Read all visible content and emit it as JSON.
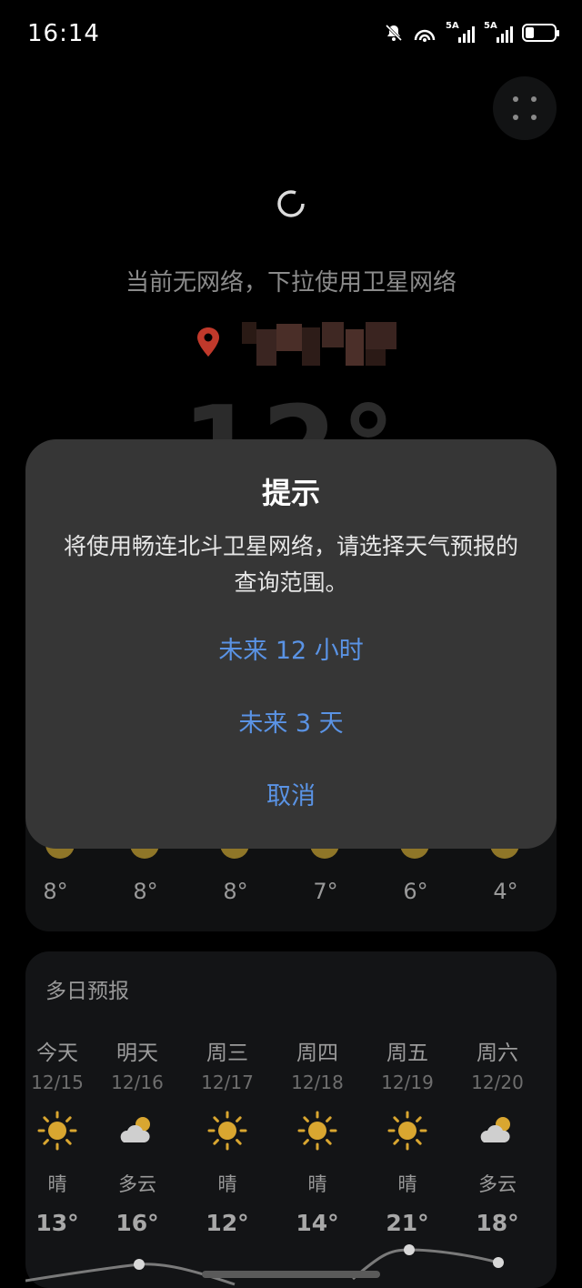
{
  "status_bar": {
    "time": "16:14",
    "signal1_label": "5A",
    "signal2_label": "5A"
  },
  "main": {
    "no_network_text": "当前无网络，下拉使用卫星网络",
    "current_temp": "12°"
  },
  "hourly": {
    "temps": [
      "8°",
      "8°",
      "8°",
      "7°",
      "6°",
      "4°"
    ]
  },
  "dialog": {
    "title": "提示",
    "message": "将使用畅连北斗卫星网络，请选择天气预报的查询范围。",
    "option_12h": "未来 12 小时",
    "option_3d": "未来 3 天",
    "cancel": "取消"
  },
  "forecast": {
    "title": "多日预报",
    "days": [
      {
        "name": "今天",
        "date": "12/15",
        "icon": "sun-icon",
        "cond": "晴",
        "temp": "13°"
      },
      {
        "name": "明天",
        "date": "12/16",
        "icon": "partly-cloudy-icon",
        "cond": "多云",
        "temp": "16°"
      },
      {
        "name": "周三",
        "date": "12/17",
        "icon": "sun-icon",
        "cond": "晴",
        "temp": "12°"
      },
      {
        "name": "周四",
        "date": "12/18",
        "icon": "sun-icon",
        "cond": "晴",
        "temp": "14°"
      },
      {
        "name": "周五",
        "date": "12/19",
        "icon": "sun-icon",
        "cond": "晴",
        "temp": "21°"
      },
      {
        "name": "周六",
        "date": "12/20",
        "icon": "partly-cloudy-icon",
        "cond": "多云",
        "temp": "18°"
      }
    ]
  },
  "colors": {
    "accent": "#5a93e5",
    "dialog_bg": "#363636",
    "location_pin": "#c0392b",
    "sun": "#d9a630"
  }
}
